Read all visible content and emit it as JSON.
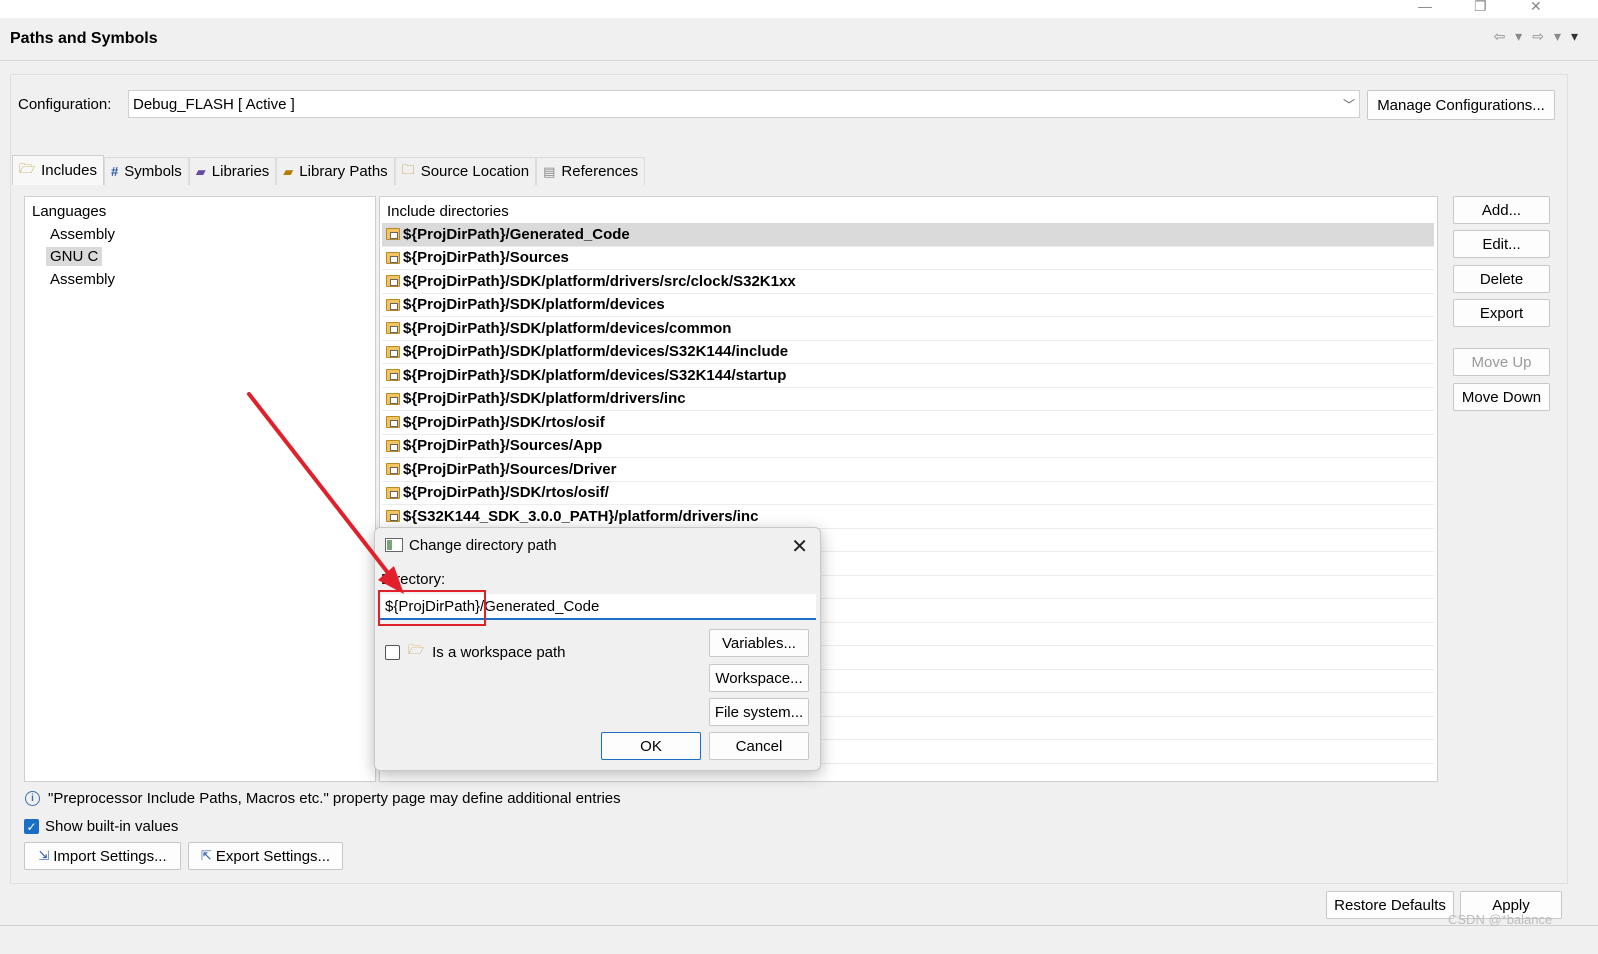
{
  "page_title": "Paths and Symbols",
  "configuration": {
    "label": "Configuration:",
    "value": "Debug_FLASH  [ Active ]",
    "manage_button": "Manage Configurations..."
  },
  "tabs": [
    {
      "label": "Includes",
      "icon": "folder-include-icon"
    },
    {
      "label": "Symbols",
      "icon": "hash-icon"
    },
    {
      "label": "Libraries",
      "icon": "library-icon"
    },
    {
      "label": "Library Paths",
      "icon": "library-path-icon"
    },
    {
      "label": "Source Location",
      "icon": "source-folder-icon"
    },
    {
      "label": "References",
      "icon": "reference-icon"
    }
  ],
  "languages": {
    "header": "Languages",
    "items": [
      "Assembly",
      "GNU C",
      "Assembly"
    ],
    "selected": "GNU C"
  },
  "include_dirs": {
    "header": "Include directories",
    "items": [
      "${ProjDirPath}/Generated_Code",
      "${ProjDirPath}/Sources",
      "${ProjDirPath}/SDK/platform/drivers/src/clock/S32K1xx",
      "${ProjDirPath}/SDK/platform/devices",
      "${ProjDirPath}/SDK/platform/devices/common",
      "${ProjDirPath}/SDK/platform/devices/S32K144/include",
      "${ProjDirPath}/SDK/platform/devices/S32K144/startup",
      "${ProjDirPath}/SDK/platform/drivers/inc",
      "${ProjDirPath}/SDK/rtos/osif",
      "${ProjDirPath}/Sources/App",
      "${ProjDirPath}/Sources/Driver",
      "${ProjDirPath}/SDK/rtos/osif/",
      "${S32K144_SDK_3.0.0_PATH}/platform/drivers/inc"
    ]
  },
  "side_buttons": {
    "add": "Add...",
    "edit": "Edit...",
    "delete": "Delete",
    "export": "Export",
    "move_up": "Move Up",
    "move_down": "Move Down"
  },
  "info_text": "\"Preprocessor Include Paths, Macros etc.\" property page may define additional entries",
  "show_builtin": "Show built-in values",
  "import_settings": "Import Settings...",
  "export_settings": "Export Settings...",
  "restore_defaults": "Restore Defaults",
  "apply": "Apply",
  "watermark": "CSDN @*balance",
  "dialog": {
    "title": "Change directory path",
    "directory_label": "Directory:",
    "directory_value": "${ProjDirPath}/Generated_Code",
    "workspace_checkbox": "Is a workspace path",
    "variables": "Variables...",
    "workspace": "Workspace...",
    "file_system": "File system...",
    "ok": "OK",
    "cancel": "Cancel"
  },
  "colors": {
    "accent": "#1a6fc4",
    "annotation": "#e0202a"
  }
}
